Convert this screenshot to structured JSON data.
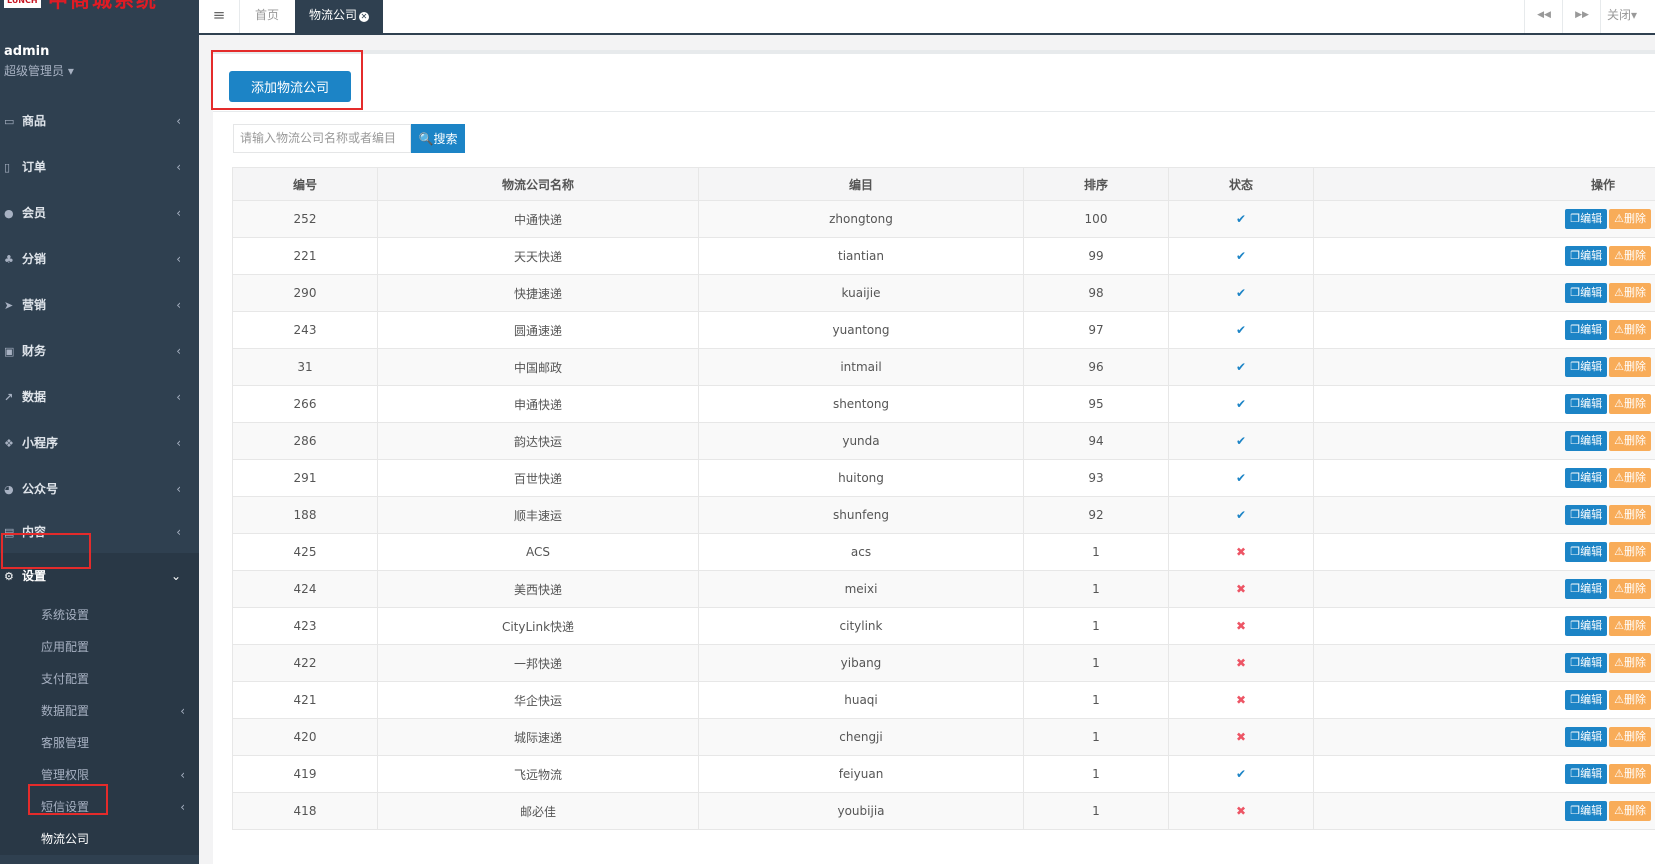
{
  "sidebar": {
    "logo_box": "LUNCH",
    "logo_text": "中商城系统",
    "user_name": "admin",
    "user_role": "超级管理员",
    "menu": [
      {
        "label": "商品",
        "icon": "monitor-icon"
      },
      {
        "label": "订单",
        "icon": "file-icon"
      },
      {
        "label": "会员",
        "icon": "user-icon"
      },
      {
        "label": "分销",
        "icon": "users-icon"
      },
      {
        "label": "营销",
        "icon": "send-icon"
      },
      {
        "label": "财务",
        "icon": "money-icon"
      },
      {
        "label": "数据",
        "icon": "chart-icon"
      },
      {
        "label": "小程序",
        "icon": "cubes-icon"
      },
      {
        "label": "公众号",
        "icon": "wechat-icon"
      },
      {
        "label": "内容",
        "icon": "book-icon"
      },
      {
        "label": "设置",
        "icon": "gear-icon"
      }
    ],
    "submenu": [
      {
        "label": "系统设置",
        "has_children": false
      },
      {
        "label": "应用配置",
        "has_children": false
      },
      {
        "label": "支付配置",
        "has_children": false
      },
      {
        "label": "数据配置",
        "has_children": true
      },
      {
        "label": "客服管理",
        "has_children": false
      },
      {
        "label": "管理权限",
        "has_children": true
      },
      {
        "label": "短信设置",
        "has_children": true
      },
      {
        "label": "物流公司",
        "has_children": false
      }
    ]
  },
  "topbar": {
    "menu_glyph": "≡",
    "home": "首页",
    "active_tab": "物流公司",
    "prev_glyph": "◀◀",
    "next_glyph": "▶▶",
    "close": "关闭"
  },
  "toolbar": {
    "add_label": "添加物流公司",
    "search_placeholder": "请输入物流公司名称或者编目",
    "search_label": "搜索"
  },
  "table": {
    "headers": [
      "编号",
      "物流公司名称",
      "编目",
      "排序",
      "状态",
      "操作"
    ],
    "edit_label": "编辑",
    "delete_label": "删除",
    "rows": [
      {
        "id": "252",
        "name": "中通快递",
        "code": "zhongtong",
        "sort": "100",
        "status": true
      },
      {
        "id": "221",
        "name": "天天快递",
        "code": "tiantian",
        "sort": "99",
        "status": true
      },
      {
        "id": "290",
        "name": "快捷速递",
        "code": "kuaijie",
        "sort": "98",
        "status": true
      },
      {
        "id": "243",
        "name": "圆通速递",
        "code": "yuantong",
        "sort": "97",
        "status": true
      },
      {
        "id": "31",
        "name": "中国邮政",
        "code": "intmail",
        "sort": "96",
        "status": true
      },
      {
        "id": "266",
        "name": "申通快递",
        "code": "shentong",
        "sort": "95",
        "status": true
      },
      {
        "id": "286",
        "name": "韵达快运",
        "code": "yunda",
        "sort": "94",
        "status": true
      },
      {
        "id": "291",
        "name": "百世快递",
        "code": "huitong",
        "sort": "93",
        "status": true
      },
      {
        "id": "188",
        "name": "顺丰速运",
        "code": "shunfeng",
        "sort": "92",
        "status": true
      },
      {
        "id": "425",
        "name": "ACS",
        "code": "acs",
        "sort": "1",
        "status": false
      },
      {
        "id": "424",
        "name": "美西快递",
        "code": "meixi",
        "sort": "1",
        "status": false
      },
      {
        "id": "423",
        "name": "CityLink快递",
        "code": "citylink",
        "sort": "1",
        "status": false
      },
      {
        "id": "422",
        "name": "一邦快递",
        "code": "yibang",
        "sort": "1",
        "status": false
      },
      {
        "id": "421",
        "name": "华企快运",
        "code": "huaqi",
        "sort": "1",
        "status": false
      },
      {
        "id": "420",
        "name": "城际速递",
        "code": "chengji",
        "sort": "1",
        "status": false
      },
      {
        "id": "419",
        "name": "飞远物流",
        "code": "feiyuan",
        "sort": "1",
        "status": true
      },
      {
        "id": "418",
        "name": "邮必佳",
        "code": "youbijia",
        "sort": "1",
        "status": false
      }
    ]
  },
  "colors": {
    "sidebar_bg": "#2f4050",
    "primary": "#1c84c6",
    "warning": "#f8ac59",
    "danger": "#ed5565",
    "highlight_box": "#e42b2b"
  }
}
